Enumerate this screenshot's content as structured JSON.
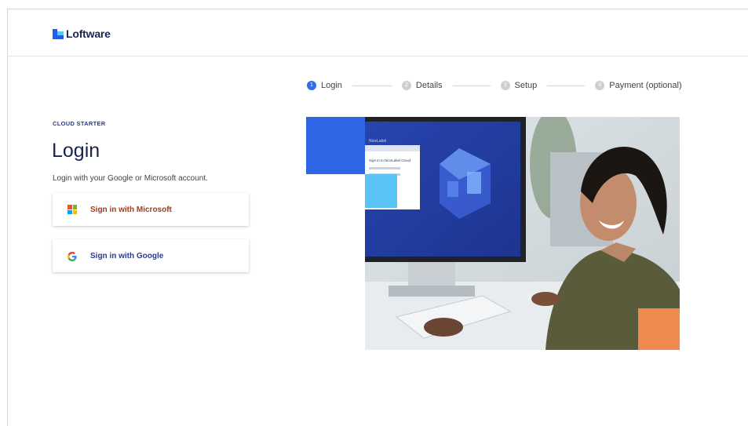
{
  "brand": {
    "name": "Loftware"
  },
  "stepper": {
    "steps": [
      {
        "num": "1",
        "label": "Login",
        "active": true
      },
      {
        "num": "2",
        "label": "Details",
        "active": false
      },
      {
        "num": "3",
        "label": "Setup",
        "active": false
      },
      {
        "num": "4",
        "label": "Payment (optional)",
        "active": false
      }
    ]
  },
  "login": {
    "eyebrow": "CLOUD STARTER",
    "title": "Login",
    "subtitle": "Login with your Google or Microsoft account.",
    "microsoft_button": {
      "label": "Sign in with Microsoft",
      "icon": "microsoft-icon"
    },
    "google_button": {
      "label": "Sign in with Google",
      "icon": "google-icon"
    }
  },
  "hero_screen": {
    "app_name": "NiceLabel",
    "card_title": "Sign in to NiceLabel Cloud"
  },
  "colors": {
    "brand_blue": "#2f66e6",
    "accent_cyan": "#5bc4f7",
    "accent_orange": "#ee8a4f",
    "heading_navy": "#1b2350",
    "microsoft_text": "#a8391a",
    "google_text": "#2b3a8c"
  }
}
